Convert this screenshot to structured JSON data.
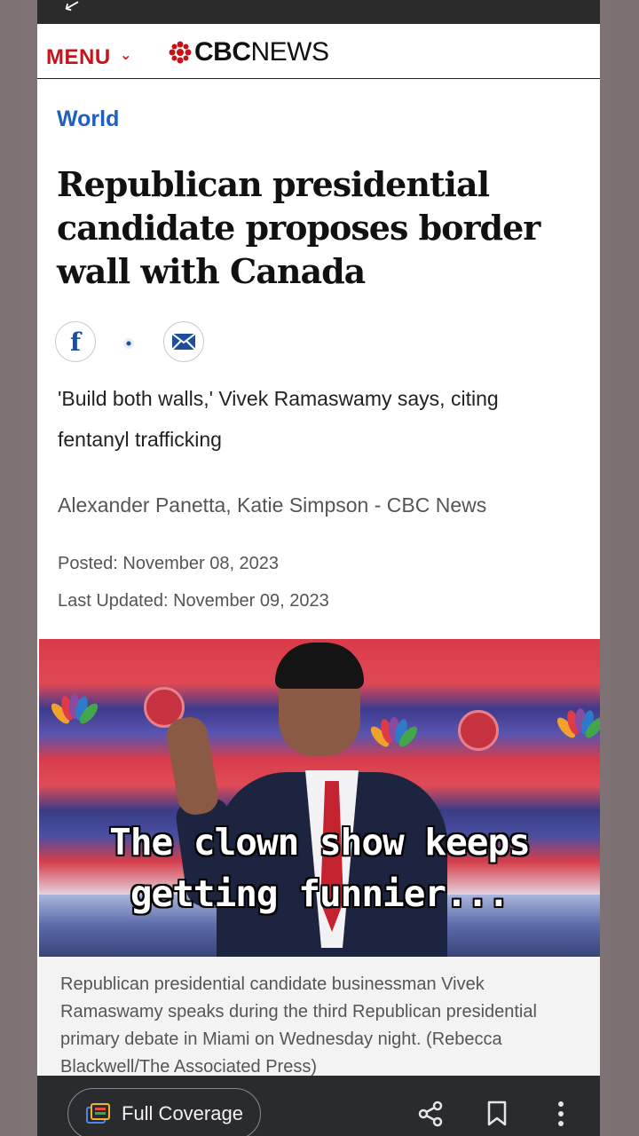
{
  "header": {
    "menu_label": "MENU",
    "logo_bold": "CBC",
    "logo_light": "NEWS",
    "brand_color": "#c4131b"
  },
  "article": {
    "section": "World",
    "headline": "Republican presidential candidate proposes border wall with Canada",
    "subheadline": "'Build both walls,' Vivek Ramaswamy says, citing fentanyl trafficking",
    "byline": "Alexander Panetta, Katie Simpson - CBC News",
    "posted": "Posted: November 08, 2023",
    "updated": "Last Updated: November 09, 2023",
    "share_icons": [
      "facebook-icon",
      "twitter-icon",
      "email-icon"
    ]
  },
  "photo": {
    "caption": "Republican presidential candidate businessman Vivek Ramaswamy speaks during the third Republican presidential primary debate in Miami on Wednesday night. (Rebecca Blackwell/The Associated Press)"
  },
  "overlay": {
    "line1": "The clown show keeps",
    "line2": "getting funnier..."
  },
  "bottom_bar": {
    "coverage_label": "Full Coverage",
    "icons": [
      "share-icon",
      "bookmark-icon",
      "more-vert-icon"
    ]
  }
}
